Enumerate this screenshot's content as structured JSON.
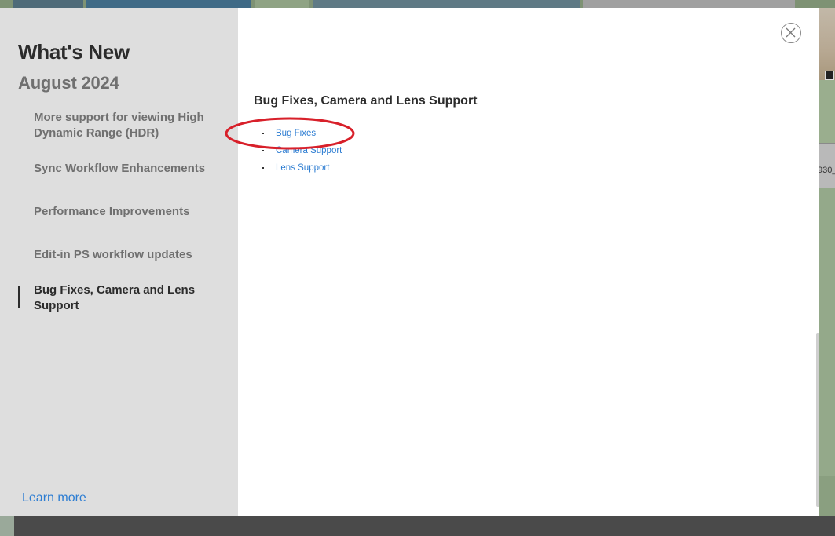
{
  "dialog": {
    "title": "What's New",
    "subtitle": "August 2024",
    "nav_items": [
      {
        "label": "More support for viewing High Dynamic Range (HDR)",
        "active": false
      },
      {
        "label": "Sync Workflow Enhancements",
        "active": false
      },
      {
        "label": "Performance Improvements",
        "active": false
      },
      {
        "label": "Edit-in PS workflow updates",
        "active": false
      },
      {
        "label": "Bug Fixes, Camera and Lens Support",
        "active": true
      }
    ],
    "learn_more": "Learn more",
    "close_icon": "close-icon"
  },
  "content": {
    "heading": "Bug Fixes, Camera and Lens Support",
    "links": [
      "Bug Fixes",
      "Camera Support",
      "Lens Support"
    ]
  },
  "background": {
    "label_fragment": "930_"
  },
  "colors": {
    "link": "#2d7dd2",
    "sidebar_bg": "#dedede",
    "annotation_circle": "#d8202a"
  }
}
